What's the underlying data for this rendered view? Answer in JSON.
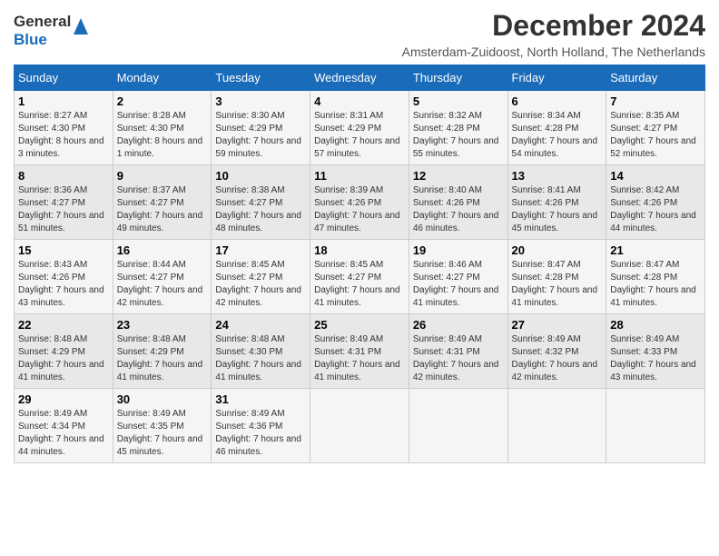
{
  "logo": {
    "line1": "General",
    "line2": "Blue"
  },
  "title": "December 2024",
  "subtitle": "Amsterdam-Zuidoost, North Holland, The Netherlands",
  "days_of_week": [
    "Sunday",
    "Monday",
    "Tuesday",
    "Wednesday",
    "Thursday",
    "Friday",
    "Saturday"
  ],
  "weeks": [
    [
      {
        "day": "1",
        "sunrise": "Sunrise: 8:27 AM",
        "sunset": "Sunset: 4:30 PM",
        "daylight": "Daylight: 8 hours and 3 minutes."
      },
      {
        "day": "2",
        "sunrise": "Sunrise: 8:28 AM",
        "sunset": "Sunset: 4:30 PM",
        "daylight": "Daylight: 8 hours and 1 minute."
      },
      {
        "day": "3",
        "sunrise": "Sunrise: 8:30 AM",
        "sunset": "Sunset: 4:29 PM",
        "daylight": "Daylight: 7 hours and 59 minutes."
      },
      {
        "day": "4",
        "sunrise": "Sunrise: 8:31 AM",
        "sunset": "Sunset: 4:29 PM",
        "daylight": "Daylight: 7 hours and 57 minutes."
      },
      {
        "day": "5",
        "sunrise": "Sunrise: 8:32 AM",
        "sunset": "Sunset: 4:28 PM",
        "daylight": "Daylight: 7 hours and 55 minutes."
      },
      {
        "day": "6",
        "sunrise": "Sunrise: 8:34 AM",
        "sunset": "Sunset: 4:28 PM",
        "daylight": "Daylight: 7 hours and 54 minutes."
      },
      {
        "day": "7",
        "sunrise": "Sunrise: 8:35 AM",
        "sunset": "Sunset: 4:27 PM",
        "daylight": "Daylight: 7 hours and 52 minutes."
      }
    ],
    [
      {
        "day": "8",
        "sunrise": "Sunrise: 8:36 AM",
        "sunset": "Sunset: 4:27 PM",
        "daylight": "Daylight: 7 hours and 51 minutes."
      },
      {
        "day": "9",
        "sunrise": "Sunrise: 8:37 AM",
        "sunset": "Sunset: 4:27 PM",
        "daylight": "Daylight: 7 hours and 49 minutes."
      },
      {
        "day": "10",
        "sunrise": "Sunrise: 8:38 AM",
        "sunset": "Sunset: 4:27 PM",
        "daylight": "Daylight: 7 hours and 48 minutes."
      },
      {
        "day": "11",
        "sunrise": "Sunrise: 8:39 AM",
        "sunset": "Sunset: 4:26 PM",
        "daylight": "Daylight: 7 hours and 47 minutes."
      },
      {
        "day": "12",
        "sunrise": "Sunrise: 8:40 AM",
        "sunset": "Sunset: 4:26 PM",
        "daylight": "Daylight: 7 hours and 46 minutes."
      },
      {
        "day": "13",
        "sunrise": "Sunrise: 8:41 AM",
        "sunset": "Sunset: 4:26 PM",
        "daylight": "Daylight: 7 hours and 45 minutes."
      },
      {
        "day": "14",
        "sunrise": "Sunrise: 8:42 AM",
        "sunset": "Sunset: 4:26 PM",
        "daylight": "Daylight: 7 hours and 44 minutes."
      }
    ],
    [
      {
        "day": "15",
        "sunrise": "Sunrise: 8:43 AM",
        "sunset": "Sunset: 4:26 PM",
        "daylight": "Daylight: 7 hours and 43 minutes."
      },
      {
        "day": "16",
        "sunrise": "Sunrise: 8:44 AM",
        "sunset": "Sunset: 4:27 PM",
        "daylight": "Daylight: 7 hours and 42 minutes."
      },
      {
        "day": "17",
        "sunrise": "Sunrise: 8:45 AM",
        "sunset": "Sunset: 4:27 PM",
        "daylight": "Daylight: 7 hours and 42 minutes."
      },
      {
        "day": "18",
        "sunrise": "Sunrise: 8:45 AM",
        "sunset": "Sunset: 4:27 PM",
        "daylight": "Daylight: 7 hours and 41 minutes."
      },
      {
        "day": "19",
        "sunrise": "Sunrise: 8:46 AM",
        "sunset": "Sunset: 4:27 PM",
        "daylight": "Daylight: 7 hours and 41 minutes."
      },
      {
        "day": "20",
        "sunrise": "Sunrise: 8:47 AM",
        "sunset": "Sunset: 4:28 PM",
        "daylight": "Daylight: 7 hours and 41 minutes."
      },
      {
        "day": "21",
        "sunrise": "Sunrise: 8:47 AM",
        "sunset": "Sunset: 4:28 PM",
        "daylight": "Daylight: 7 hours and 41 minutes."
      }
    ],
    [
      {
        "day": "22",
        "sunrise": "Sunrise: 8:48 AM",
        "sunset": "Sunset: 4:29 PM",
        "daylight": "Daylight: 7 hours and 41 minutes."
      },
      {
        "day": "23",
        "sunrise": "Sunrise: 8:48 AM",
        "sunset": "Sunset: 4:29 PM",
        "daylight": "Daylight: 7 hours and 41 minutes."
      },
      {
        "day": "24",
        "sunrise": "Sunrise: 8:48 AM",
        "sunset": "Sunset: 4:30 PM",
        "daylight": "Daylight: 7 hours and 41 minutes."
      },
      {
        "day": "25",
        "sunrise": "Sunrise: 8:49 AM",
        "sunset": "Sunset: 4:31 PM",
        "daylight": "Daylight: 7 hours and 41 minutes."
      },
      {
        "day": "26",
        "sunrise": "Sunrise: 8:49 AM",
        "sunset": "Sunset: 4:31 PM",
        "daylight": "Daylight: 7 hours and 42 minutes."
      },
      {
        "day": "27",
        "sunrise": "Sunrise: 8:49 AM",
        "sunset": "Sunset: 4:32 PM",
        "daylight": "Daylight: 7 hours and 42 minutes."
      },
      {
        "day": "28",
        "sunrise": "Sunrise: 8:49 AM",
        "sunset": "Sunset: 4:33 PM",
        "daylight": "Daylight: 7 hours and 43 minutes."
      }
    ],
    [
      {
        "day": "29",
        "sunrise": "Sunrise: 8:49 AM",
        "sunset": "Sunset: 4:34 PM",
        "daylight": "Daylight: 7 hours and 44 minutes."
      },
      {
        "day": "30",
        "sunrise": "Sunrise: 8:49 AM",
        "sunset": "Sunset: 4:35 PM",
        "daylight": "Daylight: 7 hours and 45 minutes."
      },
      {
        "day": "31",
        "sunrise": "Sunrise: 8:49 AM",
        "sunset": "Sunset: 4:36 PM",
        "daylight": "Daylight: 7 hours and 46 minutes."
      },
      null,
      null,
      null,
      null
    ]
  ]
}
